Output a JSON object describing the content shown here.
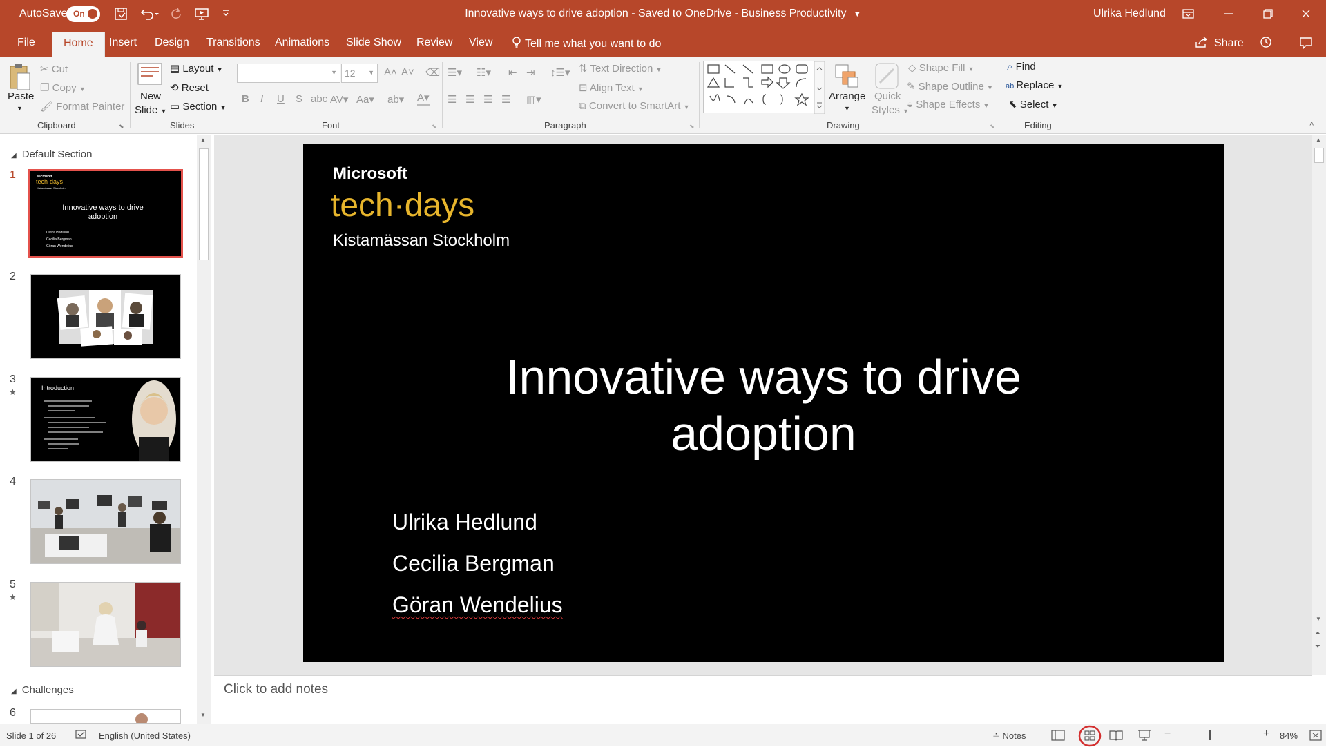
{
  "titlebar": {
    "autosave_label": "AutoSave",
    "autosave_state": "On",
    "doc_title": "Innovative ways to drive adoption  -  Saved to OneDrive - Business Productivity",
    "user": "Ulrika Hedlund"
  },
  "tabs": [
    "File",
    "Home",
    "Insert",
    "Design",
    "Transitions",
    "Animations",
    "Slide Show",
    "Review",
    "View"
  ],
  "tell_me": "Tell me what you want to do",
  "share_label": "Share",
  "ribbon": {
    "clipboard": {
      "paste": "Paste",
      "cut": "Cut",
      "copy": "Copy",
      "format_painter": "Format Painter",
      "label": "Clipboard"
    },
    "slides": {
      "new_slide_1": "New",
      "new_slide_2": "Slide",
      "layout": "Layout",
      "reset": "Reset",
      "section": "Section",
      "label": "Slides"
    },
    "font": {
      "size": "12",
      "label": "Font"
    },
    "paragraph": {
      "text_direction": "Text Direction",
      "align_text": "Align Text",
      "convert_smartart": "Convert to SmartArt",
      "label": "Paragraph"
    },
    "drawing": {
      "arrange": "Arrange",
      "quick_styles_1": "Quick",
      "quick_styles_2": "Styles",
      "shape_fill": "Shape Fill",
      "shape_outline": "Shape Outline",
      "shape_effects": "Shape Effects",
      "label": "Drawing"
    },
    "editing": {
      "find": "Find",
      "replace": "Replace",
      "select": "Select",
      "label": "Editing"
    }
  },
  "panel": {
    "section1": "Default Section",
    "section2": "Challenges",
    "slide_numbers": [
      "1",
      "2",
      "3",
      "4",
      "5",
      "6"
    ],
    "thumb1": {
      "ms": "Microsoft",
      "td": "tech·days",
      "loc": "Kistamässan Stockholm",
      "title": "Innovative ways to drive adoption",
      "names": [
        "Ulrika Hedlund",
        "Cecilia Bergman",
        "Göran Wendelius"
      ]
    },
    "thumb3": {
      "title": "Introduction"
    }
  },
  "slide": {
    "brand": "Microsoft",
    "event": "tech·days",
    "location": "Kistamässan Stockholm",
    "title_line1": "Innovative ways to drive",
    "title_line2": "adoption",
    "presenters": [
      "Ulrika Hedlund",
      "Cecilia Bergman",
      "Göran Wendelius"
    ]
  },
  "notes_placeholder": "Click to add notes",
  "status": {
    "slide_of": "Slide 1 of 26",
    "language": "English (United States)",
    "notes": "Notes",
    "zoom": "84%"
  },
  "colors": {
    "accent": "#b7472a",
    "selection": "#e4524c",
    "event_gold": "#e7b52c"
  }
}
